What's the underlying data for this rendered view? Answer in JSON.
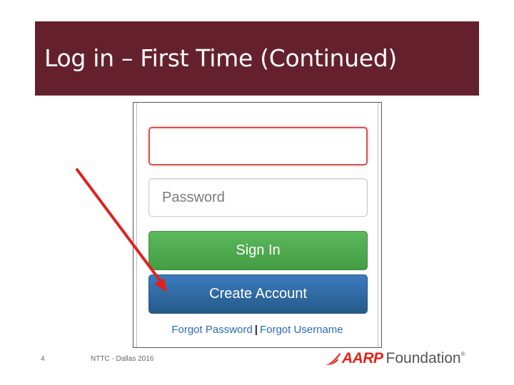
{
  "slide": {
    "title": "Log in – First Time (Continued)",
    "page_number": "4",
    "footer_text": "NTTC - Dallas 2016"
  },
  "login_form": {
    "username_value": "",
    "password_placeholder": "Password",
    "signin_label": "Sign In",
    "create_account_label": "Create Account",
    "forgot_password_label": "Forgot Password",
    "separator": "|",
    "forgot_username_label": "Forgot Username"
  },
  "annotation": {
    "arrow_color": "#e0211d",
    "points_to": "create-account-button"
  },
  "logo": {
    "brand": "AARP",
    "text": "Foundation",
    "registered": "®"
  },
  "colors": {
    "title_bar": "#65202e",
    "signin_button": "#5cb85c",
    "create_account_button": "#2e6da4",
    "link": "#2a6ab8",
    "brand_red": "#e2231a"
  }
}
